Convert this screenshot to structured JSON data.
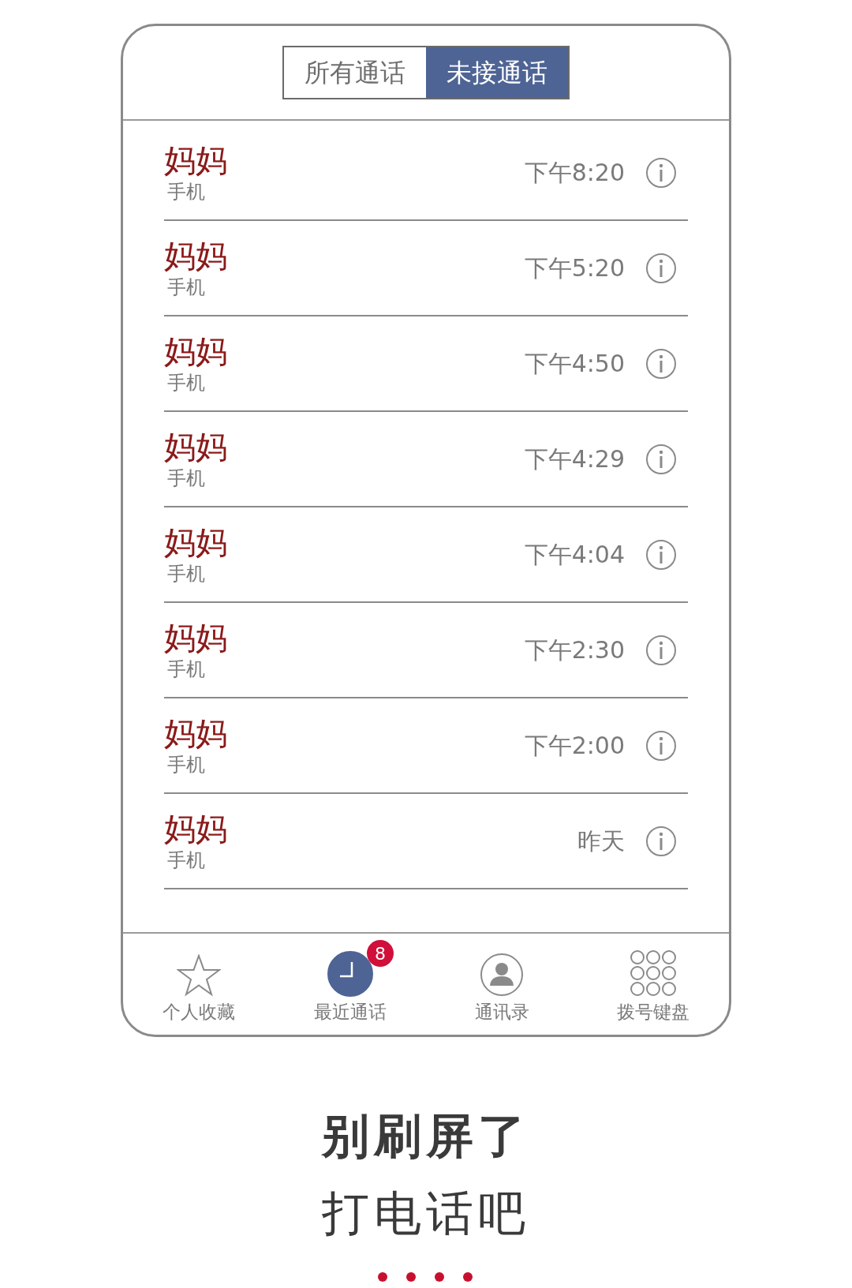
{
  "tabs": [
    {
      "label": "所有通话",
      "selected": false
    },
    {
      "label": "未接通话",
      "selected": true
    }
  ],
  "calls": [
    {
      "name": "妈妈",
      "type": "手机",
      "time": "下午8:20"
    },
    {
      "name": "妈妈",
      "type": "手机",
      "time": "下午5:20"
    },
    {
      "name": "妈妈",
      "type": "手机",
      "time": "下午4:50"
    },
    {
      "name": "妈妈",
      "type": "手机",
      "time": "下午4:29"
    },
    {
      "name": "妈妈",
      "type": "手机",
      "time": "下午4:04"
    },
    {
      "name": "妈妈",
      "type": "手机",
      "time": "下午2:30"
    },
    {
      "name": "妈妈",
      "type": "手机",
      "time": "下午2:00"
    },
    {
      "name": "妈妈",
      "type": "手机",
      "time": "昨天"
    }
  ],
  "tab_bar": [
    {
      "kind": "star",
      "label": "个人收藏",
      "selected": false
    },
    {
      "kind": "clock",
      "label": "最近通话",
      "selected": true,
      "badge": "8"
    },
    {
      "kind": "person",
      "label": "通讯录",
      "selected": false
    },
    {
      "kind": "keypad",
      "label": "拨号键盘",
      "selected": false
    }
  ],
  "caption": {
    "headline": "别刷屏了",
    "subline": "打电话吧"
  }
}
